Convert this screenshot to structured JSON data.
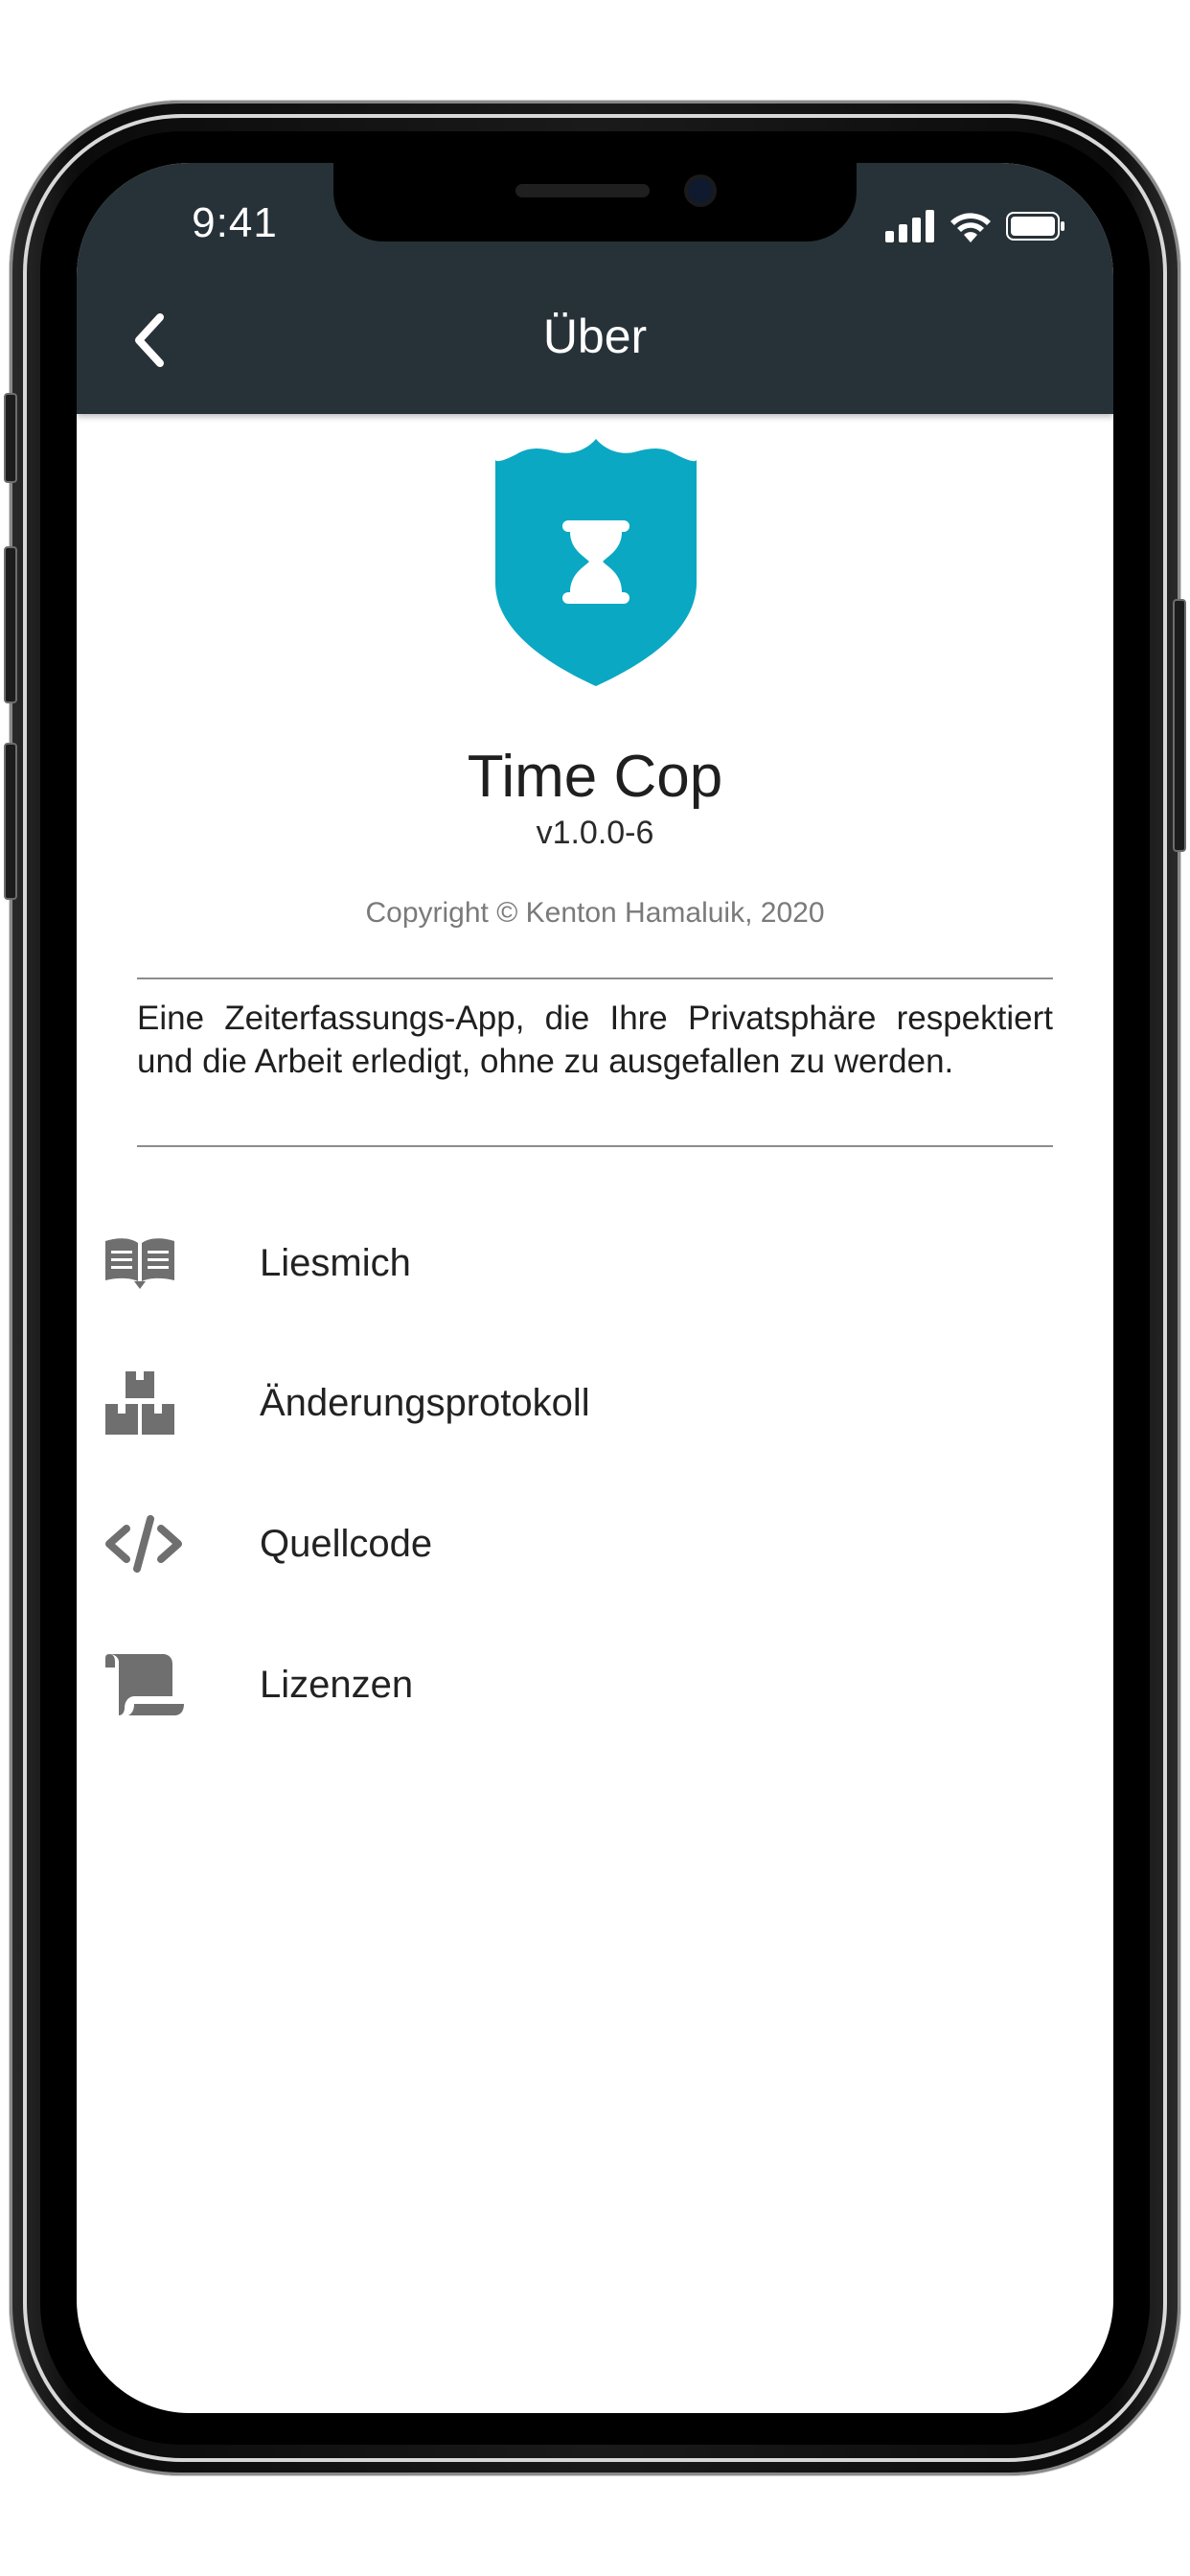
{
  "status_bar": {
    "time": "9:41"
  },
  "header": {
    "title": "Über"
  },
  "app": {
    "name": "Time Cop",
    "version": "v1.0.0-6",
    "copyright": "Copyright © Kenton Hamaluik, 2020",
    "description": "Eine Zeiterfassungs-App, die Ihre Privatsphäre respektiert und die Arbeit erledigt, ohne zu ausgefallen zu werden."
  },
  "menu": {
    "items": [
      {
        "label": "Liesmich",
        "icon": "book-open-reader-icon"
      },
      {
        "label": "Änderungsprotokoll",
        "icon": "boxes-icon"
      },
      {
        "label": "Quellcode",
        "icon": "code-icon"
      },
      {
        "label": "Lizenzen",
        "icon": "scroll-icon"
      }
    ]
  },
  "colors": {
    "header_bg": "#273238",
    "logo": "#0AA8C3",
    "icon": "#6F6F6F"
  }
}
